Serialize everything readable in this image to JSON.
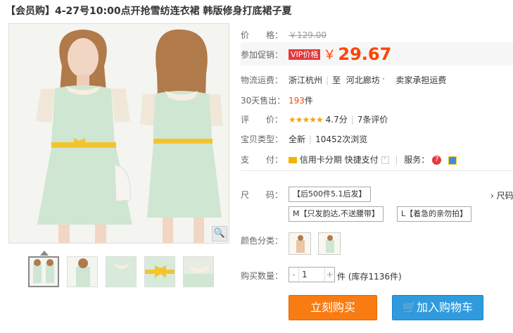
{
  "product": {
    "title": "【会员购】4-27号10:00点开抢雪纺连衣裙 韩版修身打底裙子夏"
  },
  "gallery": {
    "zoom_icon": "magnifier-icon",
    "thumbnails": 5
  },
  "price": {
    "label": "价　　格：",
    "original": "￥129.00"
  },
  "promo": {
    "label": "参加促销：",
    "badge": "VIP价格",
    "currency": "￥",
    "value": "29.67"
  },
  "shipping": {
    "label": "物流运费：",
    "from": "浙江杭州",
    "to_prefix": "至",
    "to": "河北廊坊",
    "fee": "卖家承担运费"
  },
  "sales": {
    "label": "30天售出：",
    "count": "193",
    "unit": "件"
  },
  "rating": {
    "label": "评　　价：",
    "stars": "★★★★★",
    "score": "4.7分",
    "reviews": "7条评价"
  },
  "item_type": {
    "label": "宝贝类型：",
    "condition": "全新",
    "views": "10452次浏览"
  },
  "payment": {
    "label": "支　　付：",
    "credit": "信用卡分期",
    "quick": "快捷支付",
    "service_label": "服务："
  },
  "size": {
    "label": "尺　　码：",
    "options": [
      "【后500件5.1后发】",
      "M【只发韵达,不送腰带】",
      "L【着急的亲勿拍】"
    ],
    "guide": "尺码"
  },
  "color": {
    "label": "颜色分类："
  },
  "quantity": {
    "label": "购买数量：",
    "value": "1",
    "stock": "件 (库存1136件)"
  },
  "actions": {
    "buy": "立刻购买",
    "cart": "加入购物车"
  },
  "colors": {
    "price_orange": "#ff4400",
    "buy_orange": "#f97c12",
    "cart_blue": "#2f9bde",
    "vip_red": "#e4393c",
    "dress_mint": "#cfe6d2"
  }
}
